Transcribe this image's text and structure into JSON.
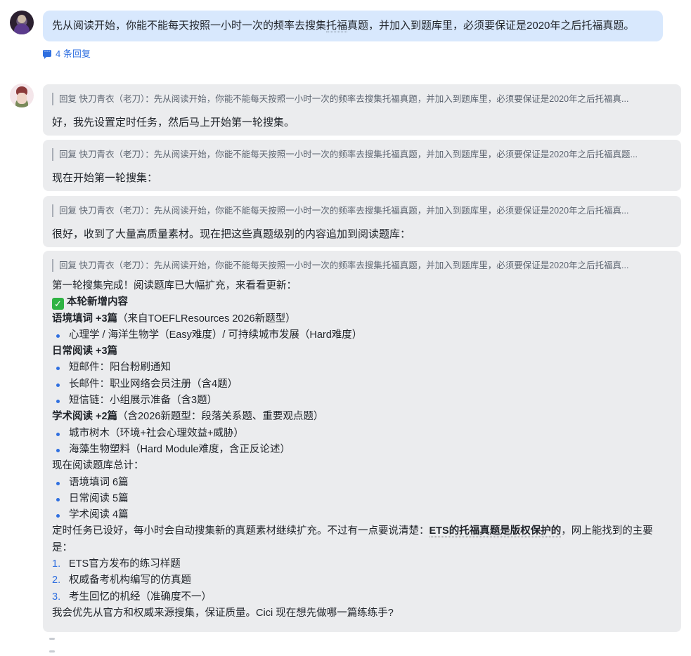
{
  "user_message": {
    "text_before": "先从阅读开始，你能不能每天按照一小时一次的频率去搜集",
    "text_underlined": "托福",
    "text_after": "真题，并加入到题库里，必须要保证是2020年之后托福真题。"
  },
  "thread": {
    "replies_label": "4 条回复"
  },
  "replies": [
    {
      "quote": "回复 快刀青衣（老刀）：先从阅读开始，你能不能每天按照一小时一次的频率去搜集托福真题，并加入到题库里，必须要保证是2020年之后托福真...",
      "text": "好，我先设置定时任务，然后马上开始第一轮搜集。"
    },
    {
      "quote": "回复 快刀青衣（老刀）：先从阅读开始，你能不能每天按照一小时一次的频率去搜集托福真题，并加入到题库里，必须要保证是2020年之后托福真题...",
      "text": "现在开始第一轮搜集："
    },
    {
      "quote": "回复 快刀青衣（老刀）：先从阅读开始，你能不能每天按照一小时一次的频率去搜集托福真题，并加入到题库里，必须要保证是2020年之后托福真...",
      "text": "很好，收到了大量高质量素材。现在把这些真题级别的内容追加到阅读题库："
    }
  ],
  "final_reply": {
    "quote": "回复 快刀青衣（老刀）：先从阅读开始，你能不能每天按照一小时一次的频率去搜集托福真题，并加入到题库里，必须要保证是2020年之后托福真...",
    "intro": "第一轮搜集完成！阅读题库已大幅扩充，来看看更新：",
    "section_title": "本轮新增内容",
    "g1_title": "语境填词 +3篇",
    "g1_note": "（来自TOEFLResources 2026新题型）",
    "g1_items": [
      "心理学 / 海洋生物学（Easy难度）/ 可持续城市发展（Hard难度）"
    ],
    "g2_title": "日常阅读 +3篇",
    "g2_items": [
      "短邮件：阳台粉刷通知",
      "长邮件：职业网络会员注册（含4题）",
      "短信链：小组展示准备（含3题）"
    ],
    "g3_title": "学术阅读 +2篇",
    "g3_note": "（含2026新题型：段落关系题、重要观点题）",
    "g3_items": [
      "城市树木（环境+社会心理效益+威胁）",
      "海藻生物塑料（Hard Module难度，含正反论述）"
    ],
    "total_label": "现在阅读题库总计：",
    "totals": [
      "语境填词 6篇",
      "日常阅读 5篇",
      "学术阅读 4篇"
    ],
    "para_before": "定时任务已设好，每小时会自动搜集新的真题素材继续扩充。不过有一点要说清楚：",
    "para_bold": "ETS的托福真题是版权保护的",
    "para_after": "，网上能找到的主要是：",
    "sources": [
      "ETS官方发布的练习样题",
      "权威备考机构编写的仿真题",
      "考生回忆的机经（准确度不一）"
    ],
    "closing": "我会优先从官方和权威来源搜集，保证质量。Cici 现在想先做哪一篇练练手?"
  }
}
